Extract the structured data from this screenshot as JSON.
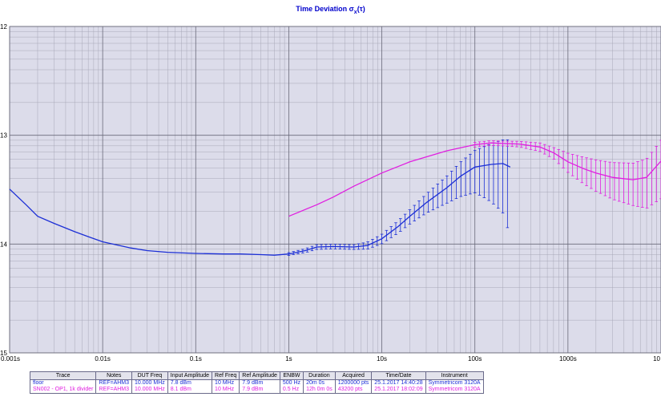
{
  "title_main": "Time Deviation σ",
  "title_sub": "x",
  "title_tail": "(τ)",
  "chart_data": {
    "type": "line",
    "title": "Time Deviation σx(τ)",
    "xscale": "log",
    "yscale": "log",
    "xlim": [
      0.001,
      10000
    ],
    "ylim": [
      1e-15,
      1e-12
    ],
    "grid": true,
    "x_ticks": [
      {
        "value": 0.001,
        "label": "0.001s"
      },
      {
        "value": 0.01,
        "label": "0.01s"
      },
      {
        "value": 0.1,
        "label": "0.1s"
      },
      {
        "value": 1,
        "label": "1s"
      },
      {
        "value": 10,
        "label": "10s"
      },
      {
        "value": 100,
        "label": "100s"
      },
      {
        "value": 1000,
        "label": "1000s"
      },
      {
        "value": 10000,
        "label": "10"
      }
    ],
    "y_ticks": [
      {
        "value": 1e-12,
        "label": "12"
      },
      {
        "value": 1e-13,
        "label": "13"
      },
      {
        "value": 1e-14,
        "label": "14"
      },
      {
        "value": 1e-15,
        "label": "15"
      }
    ],
    "series": [
      {
        "name": "floor",
        "color": "#1c2fd6",
        "points": [
          [
            0.001,
            3.2e-14
          ],
          [
            0.0015,
            2.3e-14
          ],
          [
            0.002,
            1.8e-14
          ],
          [
            0.003,
            1.55e-14
          ],
          [
            0.005,
            1.3e-14
          ],
          [
            0.007,
            1.17e-14
          ],
          [
            0.01,
            1.05e-14
          ],
          [
            0.02,
            9.2e-15
          ],
          [
            0.03,
            8.7e-15
          ],
          [
            0.05,
            8.4e-15
          ],
          [
            0.1,
            8.2e-15
          ],
          [
            0.2,
            8.1e-15
          ],
          [
            0.3,
            8.1e-15
          ],
          [
            0.5,
            8e-15
          ],
          [
            0.7,
            7.9e-15
          ],
          [
            1,
            8.1e-15
          ],
          [
            1.5,
            8.7e-15
          ],
          [
            2,
            9.4e-15
          ],
          [
            3,
            9.5e-15
          ],
          [
            5,
            9.4e-15
          ],
          [
            7,
            9.7e-15
          ],
          [
            10,
            1.12e-14
          ],
          [
            15,
            1.45e-14
          ],
          [
            20,
            1.8e-14
          ],
          [
            30,
            2.4e-14
          ],
          [
            50,
            3.3e-14
          ],
          [
            70,
            4.2e-14
          ],
          [
            100,
            5.1e-14
          ],
          [
            150,
            5.4e-14
          ],
          [
            200,
            5.5e-14
          ],
          [
            240,
            5.1e-14
          ]
        ],
        "errors": [
          [
            1,
            0.03
          ],
          [
            2,
            0.05
          ],
          [
            3,
            0.05
          ],
          [
            5,
            0.05
          ],
          [
            10,
            0.1
          ],
          [
            20,
            0.15
          ],
          [
            30,
            0.2
          ],
          [
            50,
            0.28
          ],
          [
            70,
            0.35
          ],
          [
            100,
            0.42
          ],
          [
            150,
            0.55
          ],
          [
            200,
            0.65
          ],
          [
            240,
            0.78
          ]
        ]
      },
      {
        "name": "SN002 - OP1, 1k divider",
        "color": "#e020e0",
        "points": [
          [
            1,
            1.8e-14
          ],
          [
            2,
            2.3e-14
          ],
          [
            3,
            2.7e-14
          ],
          [
            5,
            3.4e-14
          ],
          [
            10,
            4.5e-14
          ],
          [
            20,
            5.7e-14
          ],
          [
            50,
            7.2e-14
          ],
          [
            100,
            8.2e-14
          ],
          [
            150,
            8.5e-14
          ],
          [
            200,
            8.4e-14
          ],
          [
            300,
            8.3e-14
          ],
          [
            500,
            7.8e-14
          ],
          [
            700,
            6.9e-14
          ],
          [
            1000,
            5.7e-14
          ],
          [
            1500,
            4.9e-14
          ],
          [
            2000,
            4.5e-14
          ],
          [
            3000,
            4.1e-14
          ],
          [
            5000,
            3.9e-14
          ],
          [
            7000,
            4.1e-14
          ],
          [
            10000,
            5.8e-14
          ]
        ],
        "errors": [
          [
            100,
            0.05
          ],
          [
            200,
            0.05
          ],
          [
            300,
            0.06
          ],
          [
            500,
            0.09
          ],
          [
            700,
            0.12
          ],
          [
            1000,
            0.2
          ],
          [
            1500,
            0.28
          ],
          [
            2000,
            0.32
          ],
          [
            3000,
            0.37
          ],
          [
            5000,
            0.42
          ],
          [
            7000,
            0.48
          ],
          [
            10000,
            0.55
          ]
        ]
      }
    ]
  },
  "legend_table": {
    "headers": [
      "Trace",
      "Notes",
      "DUT Freq",
      "Input Amplitude",
      "Ref Freq",
      "Ref Amplitude",
      "ENBW",
      "Duration",
      "Acquired",
      "Time/Date",
      "Instrument"
    ],
    "rows": [
      {
        "color": "#1c2fd6",
        "cells": [
          "floor",
          "REF=AHM3",
          "10.000 MHz",
          "7.8 dBm",
          "10 MHz",
          "7.9 dBm",
          "500 Hz",
          "20m 0s",
          "1200000 pts",
          "25.1.2017 14:40:28",
          "Symmetricom 3120A"
        ]
      },
      {
        "color": "#e020e0",
        "cells": [
          "SN002 - OP1, 1k divider",
          "REF=AHM3",
          "10.000 MHz",
          "8.1 dBm",
          "10 MHz",
          "7.9 dBm",
          "0.5 Hz",
          "12h 0m 0s",
          "43200 pts",
          "25.1.2017 18:02:09",
          "Symmetricom 3120A"
        ]
      }
    ]
  }
}
